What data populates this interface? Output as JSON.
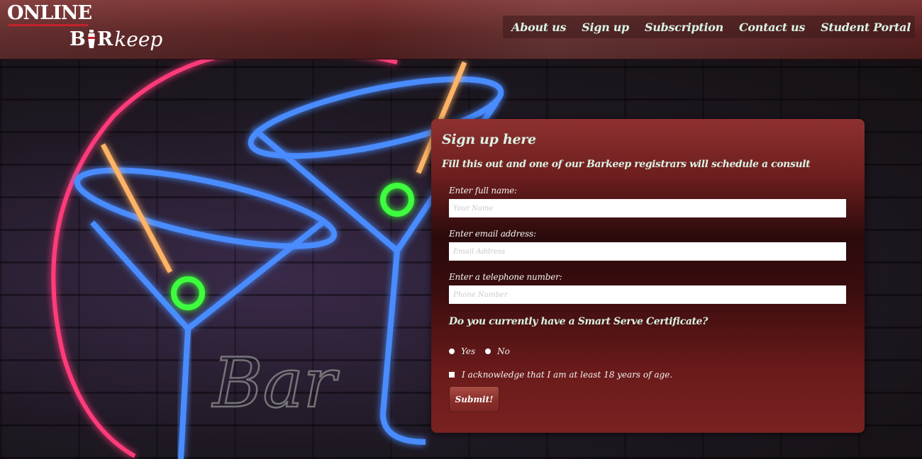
{
  "header": {
    "logo": {
      "line1": "ONLINE",
      "b": "B",
      "r": "R",
      "keep": "keep"
    },
    "nav": [
      {
        "label": "About us"
      },
      {
        "label": "Sign up"
      },
      {
        "label": "Subscription"
      },
      {
        "label": "Contact us"
      },
      {
        "label": "Student Portal"
      }
    ]
  },
  "background": {
    "sign_text": "Bar"
  },
  "form": {
    "title": "Sign up here",
    "subtitle": "Fill this out and one of our Barkeep registrars will schedule a consult",
    "fields": [
      {
        "label": "Enter full name:",
        "placeholder": "Your Name",
        "value": ""
      },
      {
        "label": "Enter email address:",
        "placeholder": "Email Address",
        "value": ""
      },
      {
        "label": "Enter a telephone number:",
        "placeholder": "Phone Number",
        "value": ""
      }
    ],
    "question": "Do you currently have a Smart Serve Certificate?",
    "options": [
      {
        "label": "Yes"
      },
      {
        "label": "No"
      }
    ],
    "acknowledge": "I acknowledge that I am at least 18 years of age.",
    "submit_label": "Submit!"
  },
  "colors": {
    "header": "#5a2222",
    "panel": "#6e1e1e",
    "accent_text": "#d9f3e4",
    "logo_underline": "#c3232c"
  }
}
